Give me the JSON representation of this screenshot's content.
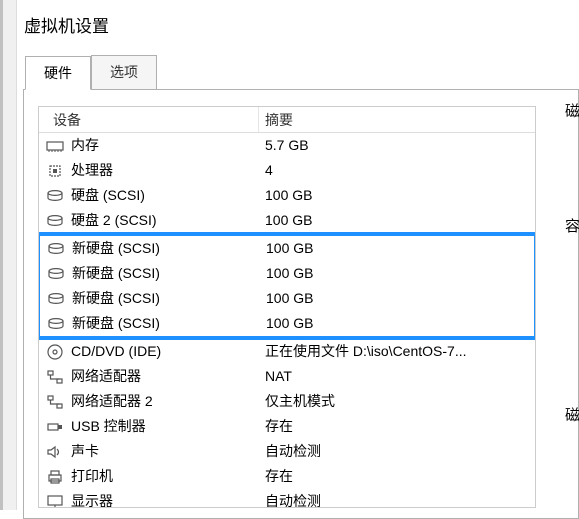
{
  "title": "虚拟机设置",
  "tabs": {
    "hardware": "硬件",
    "options": "选项"
  },
  "headers": {
    "device": "设备",
    "summary": "摘要"
  },
  "right": {
    "t1": "磁",
    "t2": "容",
    "t3": "磁"
  },
  "devices": [
    {
      "icon": "memory-icon",
      "name": "内存",
      "summary": "5.7 GB"
    },
    {
      "icon": "cpu-icon",
      "name": "处理器",
      "summary": "4"
    },
    {
      "icon": "disk-icon",
      "name": "硬盘 (SCSI)",
      "summary": "100 GB"
    },
    {
      "icon": "disk-icon",
      "name": "硬盘 2 (SCSI)",
      "summary": "100 GB"
    },
    {
      "icon": "disk-icon",
      "name": "新硬盘 (SCSI)",
      "summary": "100 GB",
      "hl": true
    },
    {
      "icon": "disk-icon",
      "name": "新硬盘 (SCSI)",
      "summary": "100 GB",
      "hl": true
    },
    {
      "icon": "disk-icon",
      "name": "新硬盘 (SCSI)",
      "summary": "100 GB",
      "hl": true
    },
    {
      "icon": "disk-icon",
      "name": "新硬盘 (SCSI)",
      "summary": "100 GB",
      "hl": true
    },
    {
      "icon": "disc-icon",
      "name": "CD/DVD (IDE)",
      "summary": "正在使用文件 D:\\iso\\CentOS-7..."
    },
    {
      "icon": "network-icon",
      "name": "网络适配器",
      "summary": "NAT"
    },
    {
      "icon": "network-icon",
      "name": "网络适配器 2",
      "summary": "仅主机模式"
    },
    {
      "icon": "usb-icon",
      "name": "USB 控制器",
      "summary": "存在"
    },
    {
      "icon": "sound-icon",
      "name": "声卡",
      "summary": "自动检测"
    },
    {
      "icon": "printer-icon",
      "name": "打印机",
      "summary": "存在"
    },
    {
      "icon": "display-icon",
      "name": "显示器",
      "summary": "自动检测"
    }
  ]
}
